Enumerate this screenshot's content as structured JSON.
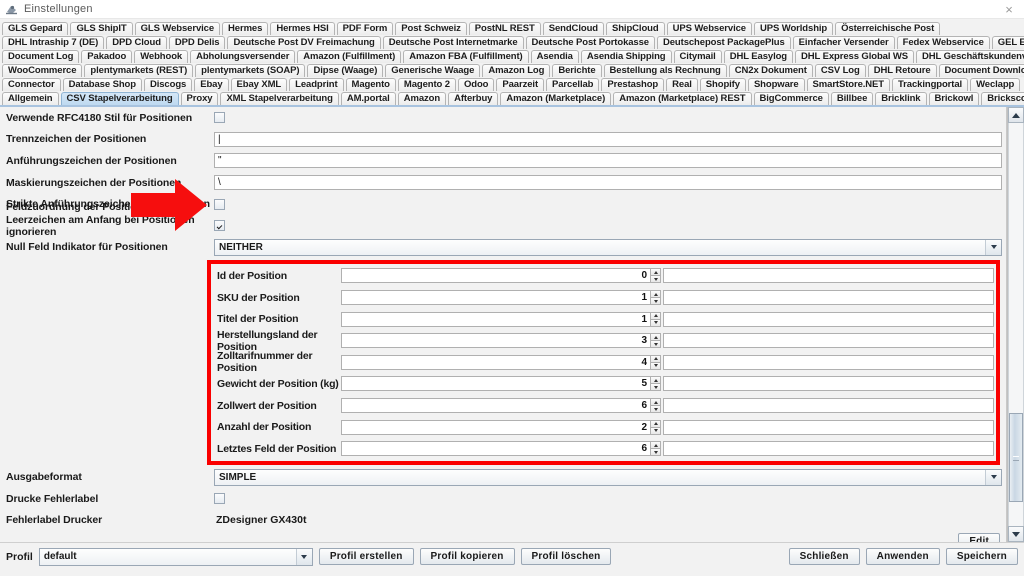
{
  "window": {
    "title": "Einstellungen",
    "icon": "app-settings-icon",
    "close_label": "×"
  },
  "tabs": {
    "rows": [
      [
        {
          "label": "GLS Gepard",
          "selected": false
        },
        {
          "label": "GLS ShipIT",
          "selected": false
        },
        {
          "label": "GLS Webservice",
          "selected": false
        },
        {
          "label": "Hermes",
          "selected": false
        },
        {
          "label": "Hermes HSI",
          "selected": false
        },
        {
          "label": "PDF Form",
          "selected": false
        },
        {
          "label": "Post Schweiz",
          "selected": false
        },
        {
          "label": "PostNL REST",
          "selected": false
        },
        {
          "label": "SendCloud",
          "selected": false
        },
        {
          "label": "ShipCloud",
          "selected": false
        },
        {
          "label": "UPS Webservice",
          "selected": false
        },
        {
          "label": "UPS Worldship",
          "selected": false
        },
        {
          "label": "Österreichische Post",
          "selected": false
        }
      ],
      [
        {
          "label": "DHL Intraship 7 (DE)",
          "selected": false
        },
        {
          "label": "DPD Cloud",
          "selected": false
        },
        {
          "label": "DPD Delis",
          "selected": false
        },
        {
          "label": "Deutsche Post DV Freimachung",
          "selected": false
        },
        {
          "label": "Deutsche Post Internetmarke",
          "selected": false
        },
        {
          "label": "Deutsche Post Portokasse",
          "selected": false
        },
        {
          "label": "Deutschepost PackagePlus",
          "selected": false
        },
        {
          "label": "Einfacher Versender",
          "selected": false
        },
        {
          "label": "Fedex Webservice",
          "selected": false
        },
        {
          "label": "GEL Express",
          "selected": false
        }
      ],
      [
        {
          "label": "Document Log",
          "selected": false
        },
        {
          "label": "Pakadoo",
          "selected": false
        },
        {
          "label": "Webhook",
          "selected": false
        },
        {
          "label": "Abholungsversender",
          "selected": false
        },
        {
          "label": "Amazon (Fulfillment)",
          "selected": false
        },
        {
          "label": "Amazon FBA (Fulfillment)",
          "selected": false
        },
        {
          "label": "Asendia",
          "selected": false
        },
        {
          "label": "Asendia Shipping",
          "selected": false
        },
        {
          "label": "Citymail",
          "selected": false
        },
        {
          "label": "DHL Easylog",
          "selected": false
        },
        {
          "label": "DHL Express Global WS",
          "selected": false
        },
        {
          "label": "DHL Geschäftskundenversand",
          "selected": false
        }
      ],
      [
        {
          "label": "WooCommerce",
          "selected": false
        },
        {
          "label": "plentymarkets (REST)",
          "selected": false
        },
        {
          "label": "plentymarkets (SOAP)",
          "selected": false
        },
        {
          "label": "Dipse (Waage)",
          "selected": false
        },
        {
          "label": "Generische Waage",
          "selected": false
        },
        {
          "label": "Amazon Log",
          "selected": false
        },
        {
          "label": "Berichte",
          "selected": false
        },
        {
          "label": "Bestellung als Rechnung",
          "selected": false
        },
        {
          "label": "CN2x Dokument",
          "selected": false
        },
        {
          "label": "CSV Log",
          "selected": false
        },
        {
          "label": "DHL Retoure",
          "selected": false
        },
        {
          "label": "Document Downloader",
          "selected": false
        }
      ],
      [
        {
          "label": "Connector",
          "selected": false
        },
        {
          "label": "Database Shop",
          "selected": false
        },
        {
          "label": "Discogs",
          "selected": false
        },
        {
          "label": "Ebay",
          "selected": false
        },
        {
          "label": "Ebay XML",
          "selected": false
        },
        {
          "label": "Leadprint",
          "selected": false
        },
        {
          "label": "Magento",
          "selected": false
        },
        {
          "label": "Magento 2",
          "selected": false
        },
        {
          "label": "Odoo",
          "selected": false
        },
        {
          "label": "Paarzeit",
          "selected": false
        },
        {
          "label": "Parcellab",
          "selected": false
        },
        {
          "label": "Prestashop",
          "selected": false
        },
        {
          "label": "Real",
          "selected": false
        },
        {
          "label": "Shopify",
          "selected": false
        },
        {
          "label": "Shopware",
          "selected": false
        },
        {
          "label": "SmartStore.NET",
          "selected": false
        },
        {
          "label": "Trackingportal",
          "selected": false
        },
        {
          "label": "Weclapp",
          "selected": false
        }
      ],
      [
        {
          "label": "Allgemein",
          "selected": false
        },
        {
          "label": "CSV Stapelverarbeitung",
          "selected": true
        },
        {
          "label": "Proxy",
          "selected": false
        },
        {
          "label": "XML Stapelverarbeitung",
          "selected": false
        },
        {
          "label": "AM.portal",
          "selected": false
        },
        {
          "label": "Amazon",
          "selected": false
        },
        {
          "label": "Afterbuy",
          "selected": false
        },
        {
          "label": "Amazon (Marketplace)",
          "selected": false
        },
        {
          "label": "Amazon (Marketplace) REST",
          "selected": false
        },
        {
          "label": "BigCommerce",
          "selected": false
        },
        {
          "label": "Billbee",
          "selected": false
        },
        {
          "label": "Bricklink",
          "selected": false
        },
        {
          "label": "Brickowl",
          "selected": false
        },
        {
          "label": "Brickscout",
          "selected": false
        }
      ]
    ]
  },
  "form": {
    "top_rows": [
      {
        "label": "Verwende RFC4180 Stil für Positionen",
        "type": "checkbox",
        "checked": false,
        "name": "rfc4180-style-checkbox"
      },
      {
        "label": "Trennzeichen der Positionen",
        "type": "text",
        "value": "|",
        "name": "positions-delimiter-field"
      },
      {
        "label": "Anführungszeichen der Positionen",
        "type": "text",
        "value": "\"",
        "name": "positions-quote-field"
      },
      {
        "label": "Maskierungszeichen der Positionen",
        "type": "text",
        "value": "\\",
        "name": "positions-escape-field"
      },
      {
        "label": "Strikte Anführungszeichen bei Positionen",
        "type": "checkbox",
        "checked": false,
        "name": "strict-quotes-checkbox"
      },
      {
        "label": "Leerzeichen am Anfang bei Positionen ignorieren",
        "type": "checkbox",
        "checked": true,
        "name": "ignore-leading-whitespace-checkbox"
      },
      {
        "label": "Null Feld Indikator für Positionen",
        "type": "combo",
        "value": "NEITHER",
        "name": "null-field-indicator-combo"
      }
    ],
    "field_mapping": {
      "label": "Feldzuordnung der Positionen",
      "arrow": "red-arrow-pointer",
      "highlight_color": "#fa0000",
      "rows": [
        {
          "label": "Id der Position",
          "value": "0",
          "name": "position-id-spinner"
        },
        {
          "label": "SKU der Position",
          "value": "1",
          "name": "position-sku-spinner"
        },
        {
          "label": "Titel der Position",
          "value": "1",
          "name": "position-title-spinner"
        },
        {
          "label": "Herstellungsland der Position",
          "value": "3",
          "name": "position-country-of-origin-spinner"
        },
        {
          "label": "Zolltarifnummer der Position",
          "value": "4",
          "name": "position-tariff-number-spinner"
        },
        {
          "label": "Gewicht der Position (kg)",
          "value": "5",
          "name": "position-weight-spinner"
        },
        {
          "label": "Zollwert der Position",
          "value": "6",
          "name": "position-customs-value-spinner"
        },
        {
          "label": "Anzahl der Position",
          "value": "2",
          "name": "position-quantity-spinner"
        },
        {
          "label": "Letztes Feld der Position",
          "value": "6",
          "name": "position-last-field-spinner"
        }
      ]
    },
    "bottom_rows": [
      {
        "label": "Ausgabeformat",
        "type": "combo",
        "value": "SIMPLE",
        "name": "output-format-combo"
      },
      {
        "label": "Drucke Fehlerlabel",
        "type": "checkbox",
        "checked": false,
        "name": "print-error-label-checkbox"
      },
      {
        "label": "Fehlerlabel Drucker",
        "type": "static",
        "value": "ZDesigner GX430t",
        "name": "error-label-printer-value"
      }
    ],
    "edit_button": "Edit"
  },
  "footer": {
    "profil_label": "Profil",
    "profil_value": "default",
    "buttons_left": [
      {
        "label": "Profil erstellen",
        "name": "create-profile-button"
      },
      {
        "label": "Profil kopieren",
        "name": "copy-profile-button"
      },
      {
        "label": "Profil löschen",
        "name": "delete-profile-button"
      }
    ],
    "buttons_right": [
      {
        "label": "Schließen",
        "name": "close-button"
      },
      {
        "label": "Anwenden",
        "name": "apply-button"
      },
      {
        "label": "Speichern",
        "name": "save-button"
      }
    ]
  }
}
